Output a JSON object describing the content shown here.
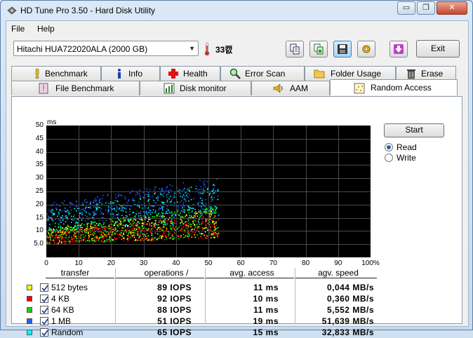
{
  "window": {
    "title": "HD Tune Pro 3.50 - Hard Disk Utility",
    "minimize_glyph": "▭",
    "maximize_glyph": "❐",
    "close_glyph": "✕"
  },
  "menu": [
    {
      "label": "File"
    },
    {
      "label": "Help"
    }
  ],
  "toolbar": {
    "drive": "Hitachi HUA722020ALA (2000 GB)",
    "temperature": "33캜",
    "exit_label": "Exit",
    "icons": [
      "copy-info-icon",
      "copy-screenshot-icon",
      "save-icon",
      "options-icon",
      "download-icon"
    ]
  },
  "tabs_row1": [
    {
      "label": "Benchmark",
      "icon": "exclamation-icon"
    },
    {
      "label": "Info",
      "icon": "info-icon"
    },
    {
      "label": "Health",
      "icon": "health-cross-icon"
    },
    {
      "label": "Error Scan",
      "icon": "magnifier-icon"
    },
    {
      "label": "Folder Usage",
      "icon": "folder-icon"
    },
    {
      "label": "Erase",
      "icon": "trash-icon"
    }
  ],
  "tabs_row2": [
    {
      "label": "File Benchmark",
      "icon": "file-benchmark-icon"
    },
    {
      "label": "Disk monitor",
      "icon": "disk-monitor-icon"
    },
    {
      "label": "AAM",
      "icon": "speaker-icon"
    },
    {
      "label": "Random Access",
      "icon": "random-access-icon",
      "selected": true
    }
  ],
  "controls": {
    "start_label": "Start",
    "read_label": "Read",
    "write_label": "Write",
    "selected_mode": "Read"
  },
  "chart_data": {
    "type": "scatter",
    "ylabel": "ms",
    "ylim": [
      0,
      50
    ],
    "xlim": [
      0,
      100
    ],
    "yticks": [
      "50",
      "45",
      "40",
      "35",
      "30",
      "25",
      "20",
      "15",
      "10",
      "5.0"
    ],
    "xticks": [
      "0",
      "10",
      "20",
      "30",
      "40",
      "50",
      "60",
      "70",
      "80",
      "90",
      "100%"
    ],
    "grid": true,
    "background": "#000000",
    "series": [
      {
        "name": "512 bytes",
        "color": "#ffff00",
        "x_range": [
          0,
          53
        ],
        "y_range": [
          5,
          16
        ]
      },
      {
        "name": "4 KB",
        "color": "#ff0000",
        "x_range": [
          0,
          53
        ],
        "y_range": [
          5,
          14
        ]
      },
      {
        "name": "64 KB",
        "color": "#00ff00",
        "x_range": [
          0,
          53
        ],
        "y_range": [
          5,
          17
        ]
      },
      {
        "name": "1 MB",
        "color": "#2060ff",
        "x_range": [
          0,
          53
        ],
        "y_range": [
          13,
          27
        ]
      },
      {
        "name": "Random",
        "color": "#00ffff",
        "x_range": [
          0,
          53
        ],
        "y_range": [
          10,
          25
        ]
      }
    ]
  },
  "table": {
    "headers": [
      "transfer",
      "operations /",
      "avg. access",
      "agv. speed"
    ],
    "rows": [
      {
        "name": "512 bytes",
        "color": "#ffff00",
        "checked": true,
        "ops": "89 IOPS",
        "access": "11 ms",
        "speed": "0,044 MB/s"
      },
      {
        "name": "4 KB",
        "color": "#ff0000",
        "checked": true,
        "ops": "92 IOPS",
        "access": "10 ms",
        "speed": "0,360 MB/s"
      },
      {
        "name": "64 KB",
        "color": "#00dd00",
        "checked": true,
        "ops": "88 IOPS",
        "access": "11 ms",
        "speed": "5,552 MB/s"
      },
      {
        "name": "1 MB",
        "color": "#2060ff",
        "checked": true,
        "ops": "51 IOPS",
        "access": "19 ms",
        "speed": "51,639 MB/s"
      },
      {
        "name": "Random",
        "color": "#00ffff",
        "checked": true,
        "ops": "65 IOPS",
        "access": "15 ms",
        "speed": "32,833 MB/s"
      }
    ]
  }
}
